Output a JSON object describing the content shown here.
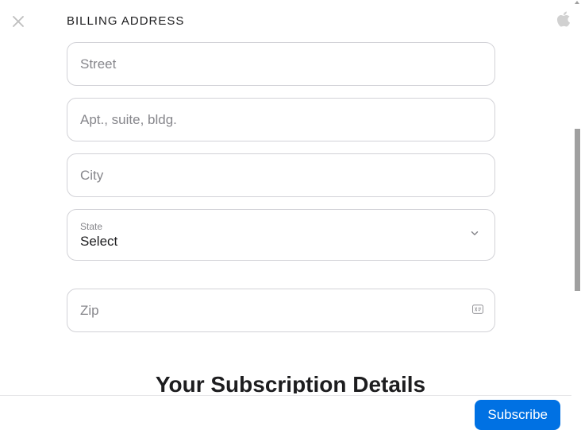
{
  "header": {
    "section_title": "BILLING ADDRESS"
  },
  "form": {
    "street": {
      "placeholder": "Street",
      "value": ""
    },
    "apt": {
      "placeholder": "Apt., suite, bldg.",
      "value": ""
    },
    "city": {
      "placeholder": "City",
      "value": ""
    },
    "state": {
      "label": "State",
      "value": "Select"
    },
    "zip": {
      "placeholder": "Zip",
      "value": ""
    }
  },
  "subscription": {
    "heading": "Your Subscription Details"
  },
  "footer": {
    "subscribe_label": "Subscribe"
  }
}
